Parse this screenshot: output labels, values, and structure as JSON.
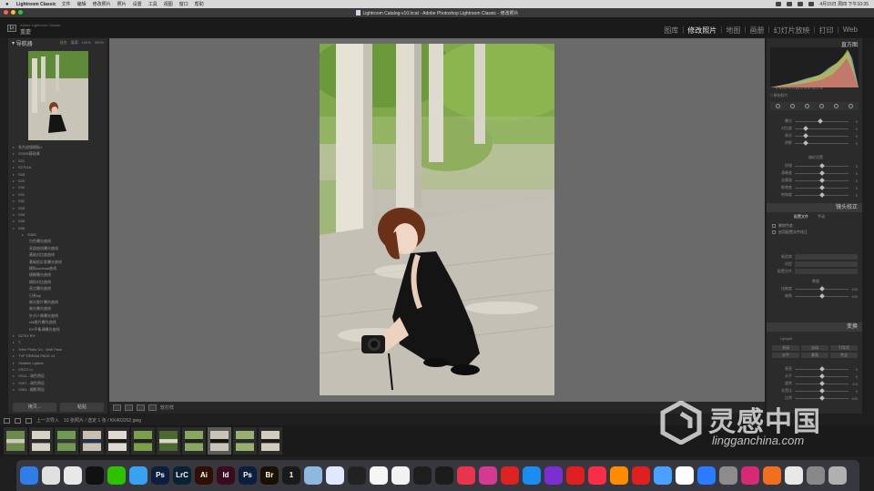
{
  "menubar": {
    "app": "Lightroom Classic",
    "items": [
      "文件",
      "编辑",
      "修改照片",
      "照片",
      "设置",
      "工具",
      "视图",
      "窗口",
      "帮助"
    ],
    "datetime": "4月15日 周四 下午10:35"
  },
  "titlebar": {
    "title": "Lightroom Catalog-v10.lrcat - Adobe Photoshop Lightroom Classic - 修改照片"
  },
  "identity": {
    "catalog": "Adobe Lightroom Classic",
    "user": "重慶"
  },
  "modules": [
    "图库",
    "修改照片",
    "地图",
    "画册",
    "幻灯片放映",
    "打印",
    "Web"
  ],
  "active_module": "修改照片",
  "left_panel": {
    "title": "导航器",
    "zoom_options": [
      "适合",
      "填满",
      "100%",
      "300%"
    ],
    "collections": [
      {
        "label": "系列滤镜模板1",
        "level": 0
      },
      {
        "label": "S2005基础课",
        "level": 0
      },
      {
        "label": "S21",
        "level": 0
      },
      {
        "label": "S2701A",
        "level": 0
      },
      {
        "label": "S28",
        "level": 0
      },
      {
        "label": "S29",
        "level": 0
      },
      {
        "label": "S30",
        "level": 0
      },
      {
        "label": "S31",
        "level": 0
      },
      {
        "label": "S32",
        "level": 0
      },
      {
        "label": "S33",
        "level": 0
      },
      {
        "label": "S34",
        "level": 0
      },
      {
        "label": "S35",
        "level": 0
      },
      {
        "label": "S36",
        "level": 0
      },
      {
        "label": "S36S",
        "level": 1
      },
      {
        "label": "白色曝光曲线",
        "level": 2
      },
      {
        "label": "亮部曲线曝光曲线",
        "level": 2
      },
      {
        "label": "基础对比度曲线",
        "level": 2
      },
      {
        "label": "基础低反差曝光曲线",
        "level": 2
      },
      {
        "label": "模拟contrast曲线",
        "level": 2
      },
      {
        "label": "模糊曝光曲线",
        "level": 2
      },
      {
        "label": "模拟对比曲线",
        "level": 2
      },
      {
        "label": "亮点曝光曲线",
        "level": 2
      },
      {
        "label": "日系fuji",
        "level": 2
      },
      {
        "label": "暗光胶片曝光曲线",
        "level": 2
      },
      {
        "label": "暗光曝光曲线",
        "level": 2
      },
      {
        "label": "针对人像曝光曲线",
        "level": 2
      },
      {
        "label": "slik胶片曝光曲线",
        "level": 2
      },
      {
        "label": "EH平衡调曝光曲线",
        "level": 2
      },
      {
        "label": "S2701 RH",
        "level": 0
      },
      {
        "label": "T",
        "level": 0
      },
      {
        "label": "Tribe Photo Co - Wolf Pack",
        "level": 0
      },
      {
        "label": "TVP DREAM PACK v3",
        "level": 0
      },
      {
        "label": "Vladimir Ljalkov",
        "level": 0
      },
      {
        "label": "VSCO Lr",
        "level": 0
      },
      {
        "label": "Y014 - 调色预设",
        "level": 0
      },
      {
        "label": "Y007 - 调色预设",
        "level": 0
      },
      {
        "label": "Y004 - 摄影预设",
        "level": 0
      }
    ],
    "copy_button": "拷贝...",
    "paste_button": "粘贴"
  },
  "toolbar": {
    "softproof_label": "软打样"
  },
  "right_panel": {
    "histogram_title": "直方图",
    "readout": "R 83.6 % G 83.8 % B 78.2 %",
    "original_label": "□ 原始照片",
    "basic_sliders": [
      {
        "label": "曝光",
        "value": "0",
        "pos": 0.48
      },
      {
        "label": "对比度",
        "value": "0",
        "pos": 0.2
      },
      {
        "label": "高光",
        "value": "0",
        "pos": 0.2
      },
      {
        "label": "阴影",
        "value": "0",
        "pos": 0.2
      }
    ],
    "presence_label": "偏好设置",
    "presence_sliders": [
      {
        "label": "纹理",
        "value": "0",
        "pos": 0.5
      },
      {
        "label": "清晰度",
        "value": "0",
        "pos": 0.5
      },
      {
        "label": "去朦胧",
        "value": "0",
        "pos": 0.5
      },
      {
        "label": "鲜艳度",
        "value": "0",
        "pos": 0.5
      },
      {
        "label": "饱和度",
        "value": "0",
        "pos": 0.5
      }
    ],
    "lens_title": "镜头校正",
    "lens_tabs": [
      "配置文件",
      "手动"
    ],
    "lens_checks": [
      "删除色差",
      "启用配置文件校正"
    ],
    "lens_fields": [
      "制造商",
      "机型",
      "配置文件"
    ],
    "amount_label": "数量",
    "amount_sliders": [
      {
        "label": "扭曲度",
        "value": "100",
        "pos": 0.5
      },
      {
        "label": "暗角",
        "value": "100",
        "pos": 0.5
      }
    ],
    "transform_title": "变换",
    "transform_mode": "Upright",
    "transform_buttons": [
      "关闭",
      "自动",
      "引导式",
      "水平",
      "垂直",
      "完全"
    ],
    "transform_sliders": [
      {
        "label": "垂直",
        "value": "0",
        "pos": 0.5
      },
      {
        "label": "水平",
        "value": "0",
        "pos": 0.5
      },
      {
        "label": "旋转",
        "value": "0.0",
        "pos": 0.5
      },
      {
        "label": "长宽比",
        "value": "0",
        "pos": 0.5
      },
      {
        "label": "比例",
        "value": "100",
        "pos": 0.5
      }
    ]
  },
  "filmstrip": {
    "source": "上一次导入",
    "info": "10 张照片 / 选定 1 张 / KK402202.jpeg",
    "thumbs": 11,
    "selected_index": 8
  },
  "watermark": {
    "title": "灵感中国",
    "subtitle": "lingganchina.com"
  },
  "dock": {
    "apps": [
      {
        "name": "finder",
        "color": "#2f7ee8",
        "glyph": ""
      },
      {
        "name": "launchpad",
        "color": "#e0e0e0",
        "glyph": ""
      },
      {
        "name": "chrome",
        "color": "#e8e8e8",
        "glyph": ""
      },
      {
        "name": "qq",
        "color": "#111111",
        "glyph": ""
      },
      {
        "name": "wechat",
        "color": "#2dc100",
        "glyph": ""
      },
      {
        "name": "browser",
        "color": "#3aa0f0",
        "glyph": ""
      },
      {
        "name": "photoshop-cc",
        "color": "#0b1e3d",
        "glyph": "Ps"
      },
      {
        "name": "lightroom-classic",
        "color": "#0a2236",
        "glyph": "LrC"
      },
      {
        "name": "illustrator",
        "color": "#2f0f02",
        "glyph": "Ai"
      },
      {
        "name": "indesign",
        "color": "#3a0b1e",
        "glyph": "Id"
      },
      {
        "name": "photoshop",
        "color": "#0b1e3d",
        "glyph": "Ps"
      },
      {
        "name": "bridge",
        "color": "#1b1000",
        "glyph": "Br"
      },
      {
        "name": "1password",
        "color": "#1a1a1a",
        "glyph": "1"
      },
      {
        "name": "preview",
        "color": "#8fb8e0",
        "glyph": ""
      },
      {
        "name": "teleport",
        "color": "#e0e8ff",
        "glyph": ""
      },
      {
        "name": "app-store-games",
        "color": "#222222",
        "glyph": ""
      },
      {
        "name": "photos",
        "color": "#f5f5f5",
        "glyph": ""
      },
      {
        "name": "pages",
        "color": "#f2f2f2",
        "glyph": ""
      },
      {
        "name": "prompt",
        "color": "#1e1e1e",
        "glyph": ""
      },
      {
        "name": "final-cut",
        "color": "#1c1c1c",
        "glyph": ""
      },
      {
        "name": "music-red",
        "color": "#e8344d",
        "glyph": ""
      },
      {
        "name": "podcast",
        "color": "#d33a92",
        "glyph": ""
      },
      {
        "name": "netease",
        "color": "#d22",
        "glyph": ""
      },
      {
        "name": "app-store",
        "color": "#1d8cf0",
        "glyph": ""
      },
      {
        "name": "affinity",
        "color": "#7b2fd0",
        "glyph": ""
      },
      {
        "name": "netease-music",
        "color": "#e02020",
        "glyph": ""
      },
      {
        "name": "apple-music",
        "color": "#fa2d48",
        "glyph": ""
      },
      {
        "name": "tencent-video",
        "color": "#ff8c00",
        "glyph": ""
      },
      {
        "name": "video",
        "color": "#e02020",
        "glyph": ""
      },
      {
        "name": "bird",
        "color": "#4aa0ff",
        "glyph": ""
      },
      {
        "name": "weibo",
        "color": "#ffffff",
        "glyph": ""
      },
      {
        "name": "wps",
        "color": "#2a7bff",
        "glyph": ""
      },
      {
        "name": "system-prefs",
        "color": "#8c8c8c",
        "glyph": ""
      },
      {
        "name": "instagram",
        "color": "#d62976",
        "glyph": ""
      },
      {
        "name": "infuse",
        "color": "#f07020",
        "glyph": ""
      },
      {
        "name": "textedit",
        "color": "#e8e8e8",
        "glyph": ""
      },
      {
        "name": "screenshot",
        "color": "#888888",
        "glyph": ""
      },
      {
        "name": "trash",
        "color": "#b0b0b0",
        "glyph": ""
      }
    ]
  }
}
